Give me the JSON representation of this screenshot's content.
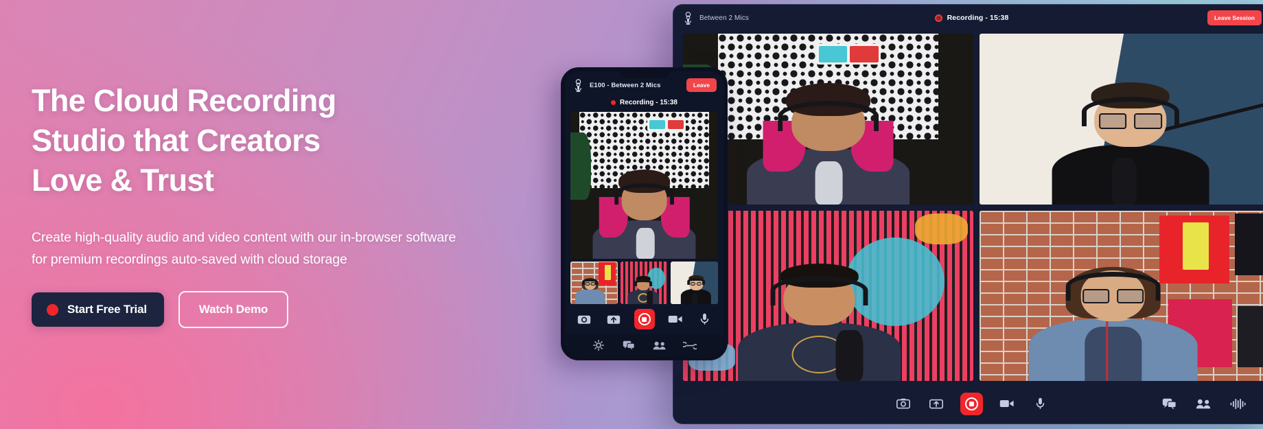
{
  "hero": {
    "headline": "The Cloud Recording\nStudio that Creators\nLove & Trust",
    "subhead": "Create high-quality audio and video content with our in-browser software\nfor premium recordings auto-saved with cloud storage",
    "primary_cta": "Start Free Trial",
    "secondary_cta": "Watch Demo",
    "gradient_colors": {
      "pink": "#f4729f",
      "purple": "#ad95cf",
      "blue": "#96c4d9"
    }
  },
  "desktop_app": {
    "brand_label": "Between 2 Mics",
    "brand_icon": "microphone-logo-icon",
    "recording_status": "Recording - 15:38",
    "recording_indicator_color": "#ef3b3b",
    "leave_button": "Leave Session",
    "leave_button_color": "#f2454a",
    "controls": [
      {
        "name": "screenshot-icon",
        "label": "Screenshot"
      },
      {
        "name": "upload-icon",
        "label": "Upload"
      },
      {
        "name": "record-icon",
        "label": "Record"
      },
      {
        "name": "video-camera-icon",
        "label": "Camera"
      },
      {
        "name": "microphone-icon",
        "label": "Microphone"
      }
    ],
    "right_controls": [
      {
        "name": "chat-icon",
        "label": "Chat"
      },
      {
        "name": "participants-icon",
        "label": "Participants"
      },
      {
        "name": "audio-waveform-icon",
        "label": "Audio Levels"
      }
    ],
    "participants": [
      {
        "id": "p1",
        "scene": "pink-hair-pattern"
      },
      {
        "id": "p2",
        "scene": "studio-split"
      },
      {
        "id": "p3",
        "scene": "stripe-mural"
      },
      {
        "id": "p4",
        "scene": "brick-records"
      }
    ]
  },
  "mobile_app": {
    "brand_label": "E100 - Between 2 Mics",
    "brand_icon": "microphone-logo-icon",
    "recording_status": "Recording - 15:38",
    "leave_button": "Leave",
    "controls": [
      {
        "name": "screenshot-icon",
        "label": "Screenshot"
      },
      {
        "name": "upload-icon",
        "label": "Upload"
      },
      {
        "name": "record-icon",
        "label": "Record"
      },
      {
        "name": "video-camera-icon",
        "label": "Camera"
      },
      {
        "name": "microphone-icon",
        "label": "Microphone"
      }
    ],
    "nav": [
      {
        "name": "settings-icon",
        "label": "Settings"
      },
      {
        "name": "chat-icon",
        "label": "Chat"
      },
      {
        "name": "participants-icon",
        "label": "Participants"
      },
      {
        "name": "link-icon",
        "label": "Invite Link"
      }
    ],
    "thumbnails": [
      {
        "id": "t1",
        "scene": "brick-records"
      },
      {
        "id": "t2",
        "scene": "stripe-mural"
      },
      {
        "id": "t3",
        "scene": "studio-split"
      }
    ]
  }
}
